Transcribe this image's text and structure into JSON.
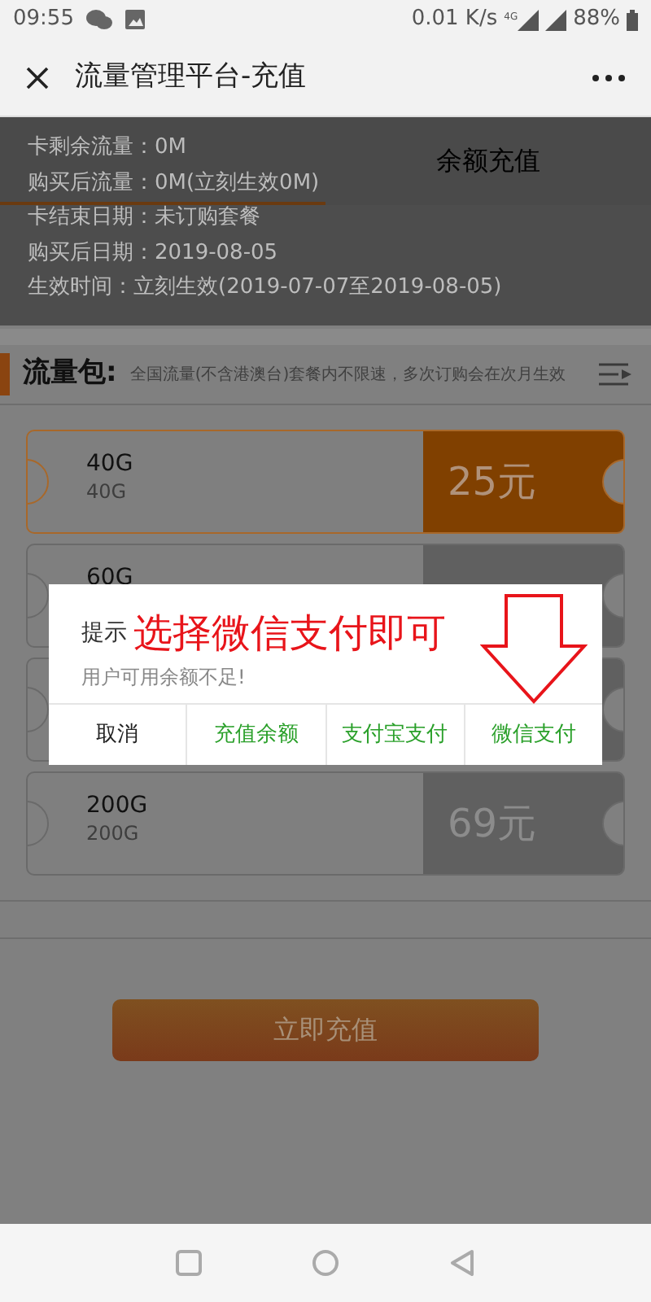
{
  "status_bar": {
    "time": "09:55",
    "speed": "0.01 K/s",
    "network": "4G",
    "battery": "88%"
  },
  "header": {
    "title": "流量管理平台-充值"
  },
  "tabs": [
    {
      "selected": true
    },
    {
      "label": "余额充值",
      "selected": false
    }
  ],
  "info_panel": {
    "lines": [
      "卡剩余流量：0M",
      "购买后流量：0M(立刻生效0M)",
      "卡结束日期：未订购套餐",
      "购买后日期：2019-08-05",
      "生效时间：立刻生效(2019-07-07至2019-08-05)"
    ]
  },
  "section": {
    "title": "流量包:",
    "note": "全国流量(不含港澳台)套餐内不限速，多次订购会在次月生效"
  },
  "packages": [
    {
      "name": "40G",
      "detail": "40G",
      "price": "25元",
      "selected": true
    },
    {
      "name": "60G",
      "selected": false
    },
    {
      "selected": false
    },
    {
      "name": "200G",
      "detail": "200G",
      "price": "69元",
      "selected": false
    }
  ],
  "submit_button": "立即充值",
  "dialog": {
    "title": "提示",
    "annotation": "选择微信支付即可",
    "message": "用户可用余额不足!",
    "buttons": [
      {
        "label": "取消",
        "kind": "cancel"
      },
      {
        "label": "充值余额",
        "kind": "option"
      },
      {
        "label": "支付宝支付",
        "kind": "option"
      },
      {
        "label": "微信支付",
        "kind": "option"
      }
    ]
  }
}
